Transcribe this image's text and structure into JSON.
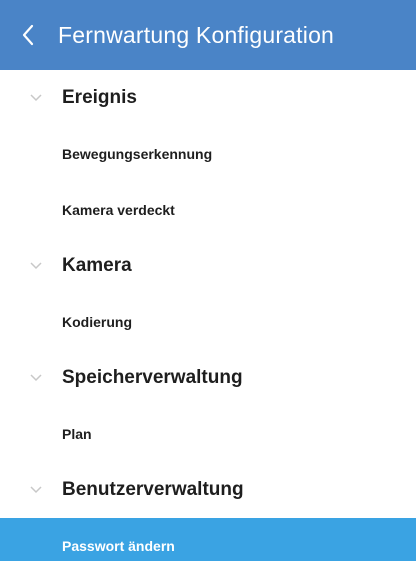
{
  "header": {
    "title": "Fernwartung Konfiguration",
    "back_icon": "chevron-left-icon",
    "background": "#4a84c7"
  },
  "sections": [
    {
      "title": "Ereignis",
      "items": [
        {
          "label": "Bewegungserkennung"
        },
        {
          "label": "Kamera verdeckt"
        }
      ]
    },
    {
      "title": "Kamera",
      "items": [
        {
          "label": "Kodierung"
        }
      ]
    },
    {
      "title": "Speicherverwaltung",
      "items": [
        {
          "label": "Plan"
        }
      ]
    },
    {
      "title": "Benutzerverwaltung",
      "items": [
        {
          "label": "Passwort ändern",
          "selected": true
        }
      ]
    }
  ],
  "colors": {
    "selected_background": "#3aa3e3",
    "text": "#1e1e1e",
    "section_chevron": "#c8c8c8"
  }
}
